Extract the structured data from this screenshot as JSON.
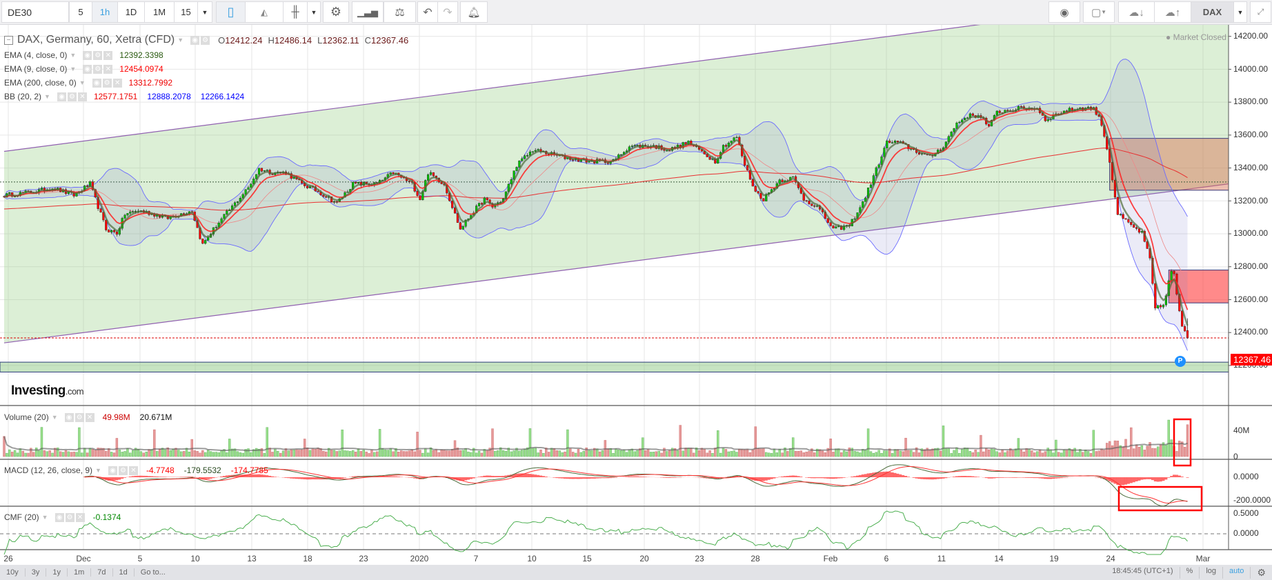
{
  "toolbar": {
    "symbol": "DE30",
    "intervals": [
      "5",
      "1h",
      "1D",
      "1M",
      "15"
    ],
    "active_interval": "1h",
    "right_symbol": "DAX",
    "icons": [
      "candles-icon",
      "line-chart-icon",
      "bar-chart-icon",
      "settings-icon",
      "indicators-icon",
      "compare-icon",
      "undo-icon",
      "redo-icon",
      "alert-icon",
      "camera-icon",
      "color-icon",
      "cloud-download-icon",
      "cloud-upload-icon",
      "fullscreen-icon"
    ]
  },
  "legend": {
    "title": "DAX, Germany, 60, Xetra (CFD)",
    "ohlc": {
      "o_label": "O",
      "o": "12412.24",
      "h_label": "H",
      "h": "12486.14",
      "l_label": "L",
      "l": "12362.11",
      "c_label": "C",
      "c": "12367.46"
    },
    "ema4": {
      "label": "EMA (4, close, 0)",
      "value": "12392.3398"
    },
    "ema9": {
      "label": "EMA (9, close, 0)",
      "value": "12454.0974"
    },
    "ema200": {
      "label": "EMA (200, close, 0)",
      "value": "13312.7992"
    },
    "bb": {
      "label": "BB (20, 2)",
      "v1": "12577.1751",
      "v2": "12888.2078",
      "v3": "12266.1424"
    }
  },
  "market_status": "Market Closed",
  "last_price": "12367.46",
  "marker": "P",
  "logo": {
    "main": "Investing",
    "suffix": ".com"
  },
  "volume": {
    "label": "Volume (20)",
    "v1": "49.98M",
    "v2": "20.671M",
    "axis": [
      "40M",
      "0"
    ]
  },
  "macd": {
    "label": "MACD (12, 26, close, 9)",
    "v1": "-4.7748",
    "v2": "-179.5532",
    "v3": "-174.7785",
    "axis": [
      "0.0000",
      "-200.0000"
    ]
  },
  "cmf": {
    "label": "CMF (20)",
    "v1": "-0.1374",
    "axis": [
      "0.5000",
      "0.0000"
    ]
  },
  "price_axis": [
    "14200.00",
    "14000.00",
    "13800.00",
    "13600.00",
    "13400.00",
    "13200.00",
    "13000.00",
    "12800.00",
    "12600.00",
    "12400.00",
    "12200.00"
  ],
  "time_axis": [
    "26",
    "Dec",
    "5",
    "10",
    "13",
    "18",
    "23",
    "2020",
    "7",
    "10",
    "15",
    "20",
    "23",
    "28",
    "Feb",
    "6",
    "11",
    "14",
    "19",
    "24",
    "Mar"
  ],
  "bottom": {
    "ranges": [
      "10y",
      "3y",
      "1y",
      "1m",
      "7d",
      "1d",
      "Go to..."
    ],
    "clock": "18:45:45 (UTC+1)",
    "pct": "%",
    "log": "log",
    "auto": "auto"
  },
  "chart_data": {
    "type": "candlestick",
    "title": "DAX, Germany, 60, Xetra (CFD)",
    "ylim": [
      12100,
      14300
    ],
    "bars": 442,
    "last_bar": {
      "open": 12412.24,
      "high": 12486.14,
      "low": 12362.11,
      "close": 12367.46
    },
    "close_keypoints": [
      [
        0,
        13234
      ],
      [
        12,
        13257
      ],
      [
        18,
        13280
      ],
      [
        26,
        13234
      ],
      [
        32,
        13303
      ],
      [
        35,
        13165
      ],
      [
        38,
        13027
      ],
      [
        42,
        13004
      ],
      [
        45,
        13119
      ],
      [
        50,
        13142
      ],
      [
        56,
        13119
      ],
      [
        61,
        13096
      ],
      [
        70,
        13142
      ],
      [
        73,
        12981
      ],
      [
        74,
        12935
      ],
      [
        79,
        13050
      ],
      [
        85,
        13165
      ],
      [
        91,
        13280
      ],
      [
        95,
        13395
      ],
      [
        100,
        13372
      ],
      [
        105,
        13372
      ],
      [
        111,
        13303
      ],
      [
        117,
        13257
      ],
      [
        124,
        13188
      ],
      [
        130,
        13303
      ],
      [
        139,
        13303
      ],
      [
        145,
        13372
      ],
      [
        152,
        13303
      ],
      [
        155,
        13211
      ],
      [
        158,
        13372
      ],
      [
        164,
        13303
      ],
      [
        167,
        13165
      ],
      [
        170,
        13027
      ],
      [
        174,
        13119
      ],
      [
        179,
        13211
      ],
      [
        182,
        13165
      ],
      [
        186,
        13211
      ],
      [
        191,
        13418
      ],
      [
        197,
        13510
      ],
      [
        203,
        13487
      ],
      [
        209,
        13464
      ],
      [
        218,
        13441
      ],
      [
        227,
        13441
      ],
      [
        233,
        13533
      ],
      [
        242,
        13533
      ],
      [
        248,
        13510
      ],
      [
        255,
        13556
      ],
      [
        261,
        13487
      ],
      [
        265,
        13441
      ],
      [
        268,
        13533
      ],
      [
        273,
        13588
      ],
      [
        276,
        13418
      ],
      [
        280,
        13257
      ],
      [
        283,
        13211
      ],
      [
        289,
        13326
      ],
      [
        294,
        13340
      ],
      [
        298,
        13211
      ],
      [
        303,
        13165
      ],
      [
        309,
        13027
      ],
      [
        315,
        13050
      ],
      [
        320,
        13188
      ],
      [
        324,
        13349
      ],
      [
        329,
        13556
      ],
      [
        333,
        13556
      ],
      [
        339,
        13510
      ],
      [
        345,
        13464
      ],
      [
        350,
        13533
      ],
      [
        355,
        13671
      ],
      [
        359,
        13717
      ],
      [
        364,
        13717
      ],
      [
        367,
        13648
      ],
      [
        370,
        13740
      ],
      [
        379,
        13763
      ],
      [
        385,
        13763
      ],
      [
        388,
        13694
      ],
      [
        394,
        13740
      ],
      [
        400,
        13763
      ],
      [
        406,
        13763
      ],
      [
        409,
        13671
      ],
      [
        412,
        13441
      ],
      [
        415,
        13119
      ],
      [
        420,
        13050
      ],
      [
        424,
        13004
      ],
      [
        427,
        12844
      ],
      [
        429,
        12544
      ],
      [
        432,
        12567
      ],
      [
        435,
        12774
      ],
      [
        436,
        12751
      ],
      [
        438,
        12521
      ],
      [
        439,
        12430
      ],
      [
        441,
        12367.46
      ]
    ],
    "drawings": {
      "channel_upper": [
        [
          0,
          13501
        ],
        [
          358,
          14260
        ]
      ],
      "channel_lower": [
        [
          0,
          12337
        ],
        [
          456,
          13303
        ]
      ],
      "zone_1": {
        "from_bar": 412,
        "top": 13580,
        "bottom": 13265
      },
      "zone_2": {
        "from_bar": 434,
        "top": 12780,
        "bottom": 12580
      },
      "support_band": {
        "top": 12220,
        "bottom": 12160
      },
      "hline": 13315
    },
    "colors": {
      "up": "#00c000",
      "down": "#ff0000",
      "ema4": "#4f6b3a",
      "ema9": "#ff2020",
      "ema200": "#e83030",
      "bb": "#6a6aff",
      "channel": "#9060b0"
    }
  }
}
